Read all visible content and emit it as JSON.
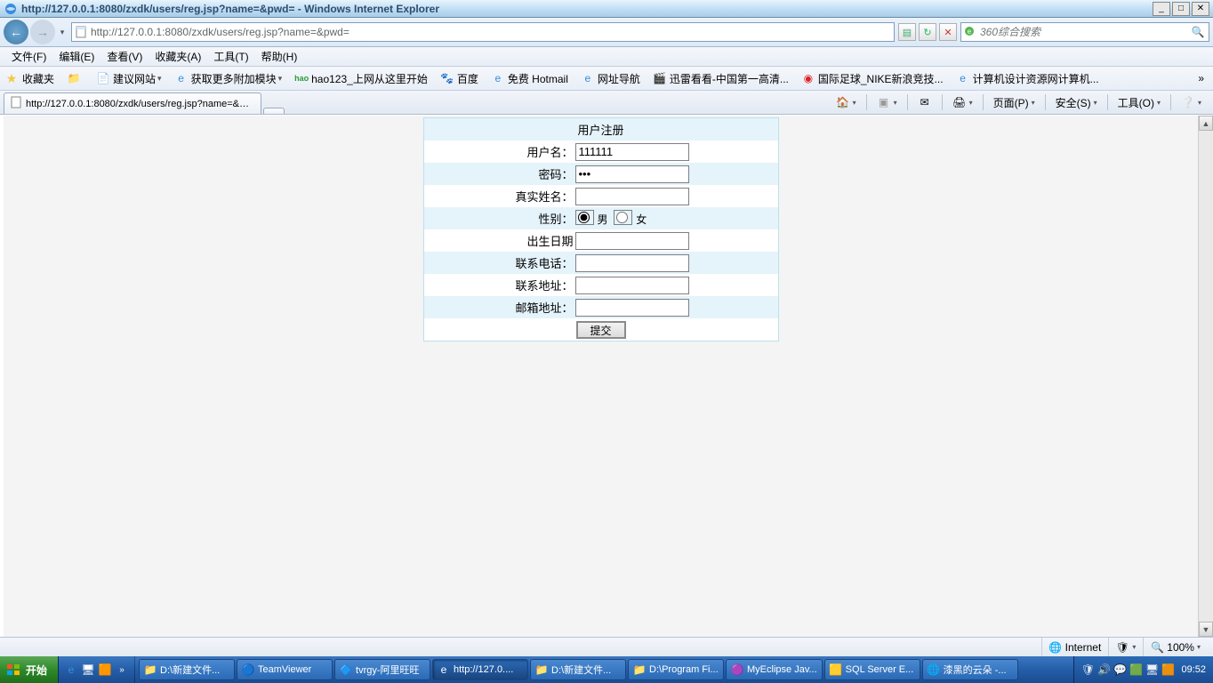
{
  "window": {
    "title": "http://127.0.0.1:8080/zxdk/users/reg.jsp?name=&pwd= - Windows Internet Explorer",
    "url": "http://127.0.0.1:8080/zxdk/users/reg.jsp?name=&pwd=",
    "search_placeholder": "360综合搜索"
  },
  "menu": {
    "file": "文件(F)",
    "edit": "编辑(E)",
    "view": "查看(V)",
    "favorites": "收藏夹(A)",
    "tools": "工具(T)",
    "help": "帮助(H)"
  },
  "favbar": {
    "label": "收藏夹",
    "items": [
      "建议网站",
      "获取更多附加模块",
      "hao123_上网从这里开始",
      "百度",
      "免费 Hotmail",
      "网址导航",
      "迅雷看看-中国第一高清...",
      "国际足球_NIKE新浪竞技...",
      "计算机设计资源网计算机..."
    ]
  },
  "tab": {
    "title": "http://127.0.0.1:8080/zxdk/users/reg.jsp?name=&p..."
  },
  "cmdbar": {
    "page": "页面(P)",
    "safety": "安全(S)",
    "tools": "工具(O)"
  },
  "form": {
    "title": "用户注册",
    "labels": {
      "username": "用户名：",
      "password": "密码：",
      "realname": "真实姓名：",
      "gender": "性别：",
      "birth": "出生日期",
      "phone": "联系电话：",
      "address": "联系地址：",
      "email": "邮箱地址："
    },
    "values": {
      "username": "111111",
      "password": "•••",
      "realname": "",
      "birth": "",
      "phone": "",
      "address": "",
      "email": ""
    },
    "gender": {
      "male": "男",
      "female": "女",
      "selected": "male"
    },
    "submit": "提交"
  },
  "status": {
    "zone": "Internet",
    "zoom": "100%"
  },
  "taskbar": {
    "start": "开始",
    "tasks": [
      "D:\\新建文件...",
      "TeamViewer",
      "tvrgy-阿里旺旺",
      "http://127.0....",
      "D:\\新建文件...",
      "D:\\Program Fi...",
      "MyEclipse Jav...",
      "SQL Server E...",
      "漆黑的云朵 -..."
    ],
    "active_task_index": 3,
    "clock": "09:52"
  }
}
